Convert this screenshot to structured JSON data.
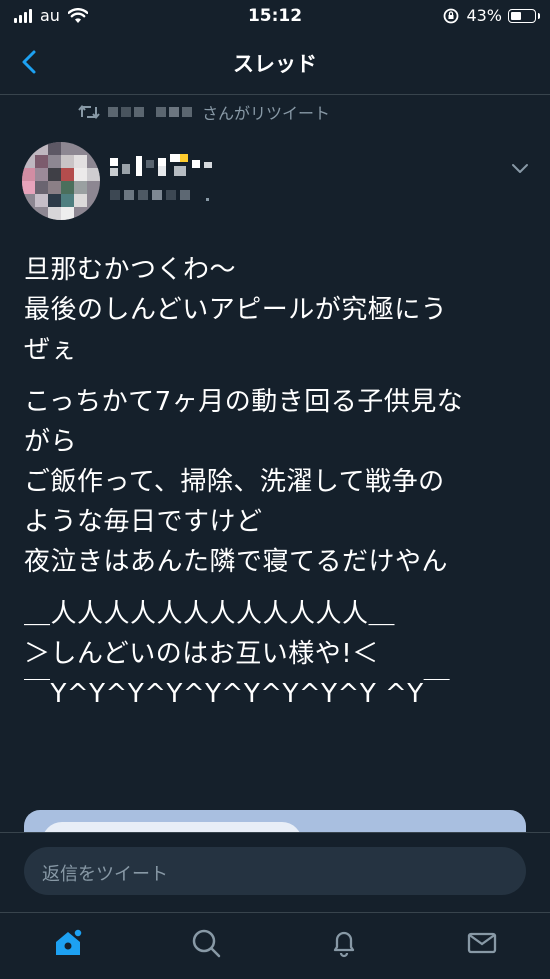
{
  "status_bar": {
    "carrier": "au",
    "time": "15:12",
    "battery_percent": "43%",
    "battery_level": 0.43
  },
  "nav": {
    "title": "スレッド",
    "back_icon": "chevron-left-icon"
  },
  "retweet": {
    "suffix": "さんがリツイート",
    "icon": "retweet-icon"
  },
  "tweet": {
    "paragraphs": [
      "旦那むかつくわ〜\n最後のしんどいアピールが究極にう\nぜぇ",
      "こっちかて7ヶ月の動き回る子供見な\nがら\nご飯作って、掃除、洗濯して戦争の\nような毎日ですけど\n夜泣きはあんた隣で寝てるだけやん",
      "＿人人人人人人人人人人人人＿\n＞しんどいのはお互い様や!＜\n￣Y^Y^Y^Y^Y^Y^Y^Y^Y ^Y￣"
    ]
  },
  "reply": {
    "placeholder": "返信をツイート"
  },
  "tabs": [
    {
      "name": "home",
      "icon": "home-icon",
      "active": true
    },
    {
      "name": "search",
      "icon": "search-icon",
      "active": false
    },
    {
      "name": "notifications",
      "icon": "bell-icon",
      "active": false
    },
    {
      "name": "messages",
      "icon": "mail-icon",
      "active": false
    }
  ],
  "colors": {
    "background": "#15202b",
    "accent": "#1da1f2",
    "secondary_text": "#8899a6",
    "divider": "#38444d"
  }
}
